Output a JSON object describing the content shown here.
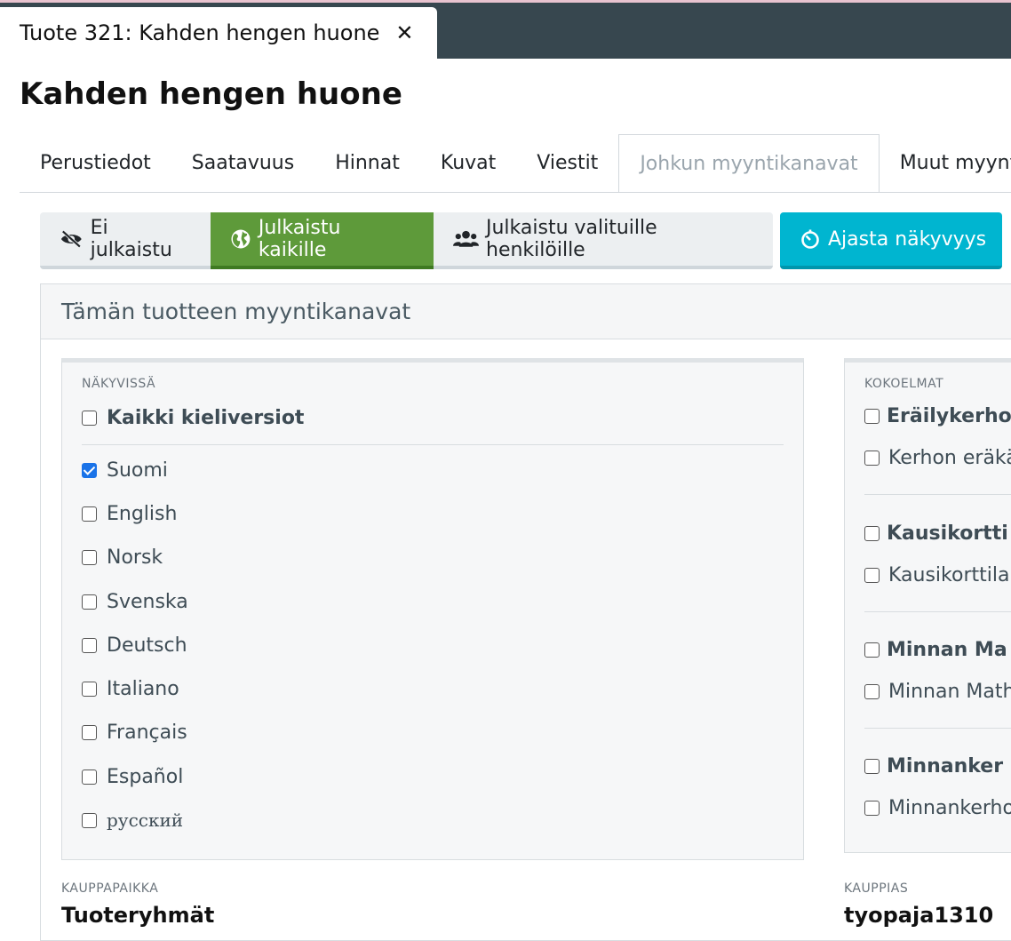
{
  "tab": {
    "title": "Tuote 321: Kahden hengen huone",
    "close_label": "✕"
  },
  "page": {
    "title": "Kahden hengen huone"
  },
  "nav_tabs": [
    {
      "label": "Perustiedot"
    },
    {
      "label": "Saatavuus"
    },
    {
      "label": "Hinnat"
    },
    {
      "label": "Kuvat"
    },
    {
      "label": "Viestit"
    },
    {
      "label": "Johkun myyntikanavat",
      "active": true
    },
    {
      "label": "Muut myyntikanavat"
    }
  ],
  "publish": {
    "not_published": "Ei julkaistu",
    "published_all": "Julkaistu kaikille",
    "published_selected": "Julkaistu valituille henkilöille",
    "schedule": "Ajasta näkyvyys"
  },
  "panel": {
    "title": "Tämän tuotteen myyntikanavat"
  },
  "visible": {
    "label": "NÄKYVISSÄ",
    "all_languages": "Kaikki kieliversiot",
    "languages": [
      {
        "label": "Suomi",
        "checked": true
      },
      {
        "label": "English",
        "checked": false
      },
      {
        "label": "Norsk",
        "checked": false
      },
      {
        "label": "Svenska",
        "checked": false
      },
      {
        "label": "Deutsch",
        "checked": false
      },
      {
        "label": "Italiano",
        "checked": false
      },
      {
        "label": "Français",
        "checked": false
      },
      {
        "label": "Español",
        "checked": false
      },
      {
        "label": "русский",
        "checked": false
      }
    ]
  },
  "collections": {
    "label": "KOKOELMAT",
    "groups": [
      {
        "title": "Eräilykerhon",
        "item": "Kerhon eräkä"
      },
      {
        "title": "Kausikortti",
        "item": "Kausikorttila"
      },
      {
        "title": "Minnan Ma",
        "item": "Minnan Math"
      },
      {
        "title": "Minnanker",
        "item": "Minnankerho"
      }
    ]
  },
  "footer": {
    "marketplace_label": "KAUPPAPAIKKA",
    "marketplace_title": "Tuoteryhmät",
    "merchant_label": "KAUPPIAS",
    "merchant_title": "tyopaja1310"
  },
  "colors": {
    "topbar": "#37474f",
    "active_green": "#5e9a3a",
    "cyan": "#00b5d0",
    "checkbox_blue": "#1a73e8"
  }
}
